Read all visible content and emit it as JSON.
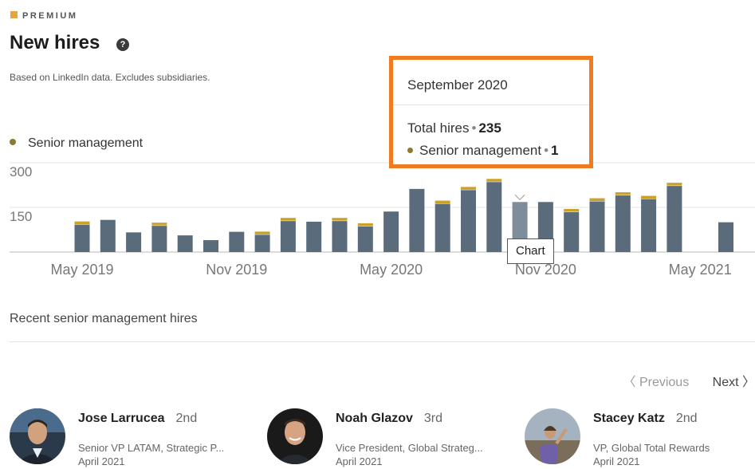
{
  "header": {
    "premium_label": "PREMIUM",
    "title": "New hires",
    "subtitle": "Based on LinkedIn data. Excludes subsidiaries."
  },
  "legend": {
    "label": "Senior management"
  },
  "chart_data": {
    "type": "bar",
    "stacked": true,
    "ylim": [
      0,
      300
    ],
    "y_ticks": [
      "300",
      "150"
    ],
    "x_tick_labels": [
      "May 2019",
      "Nov 2019",
      "May 2020",
      "Nov 2020",
      "May 2021"
    ],
    "x_tick_indices": [
      0,
      6,
      12,
      18,
      24
    ],
    "categories": [
      "Apr 2019",
      "May 2019",
      "Jun 2019",
      "Jul 2019",
      "Aug 2019",
      "Sep 2019",
      "Oct 2019",
      "Nov 2019",
      "Dec 2019",
      "Jan 2020",
      "Feb 2020",
      "Mar 2020",
      "Apr 2020",
      "May 2020",
      "Jun 2020",
      "Jul 2020",
      "Aug 2020",
      "Sep 2020",
      "Oct 2020",
      "Nov 2020",
      "Dec 2020",
      "Jan 2021",
      "Feb 2021",
      "Mar 2021",
      "Apr 2021",
      "May 2021"
    ],
    "highlight_index": 17,
    "series": [
      {
        "name": "Total hires",
        "color": "#5a6b7b",
        "values": [
          92,
          108,
          66,
          88,
          56,
          40,
          68,
          58,
          104,
          102,
          104,
          86,
          136,
          212,
          162,
          208,
          235,
          168,
          168,
          134,
          170,
          190,
          178,
          222,
          0,
          100
        ]
      },
      {
        "name": "Senior management",
        "color": "#c9a227",
        "values": [
          1,
          0,
          0,
          1,
          0,
          0,
          0,
          1,
          1,
          0,
          1,
          1,
          0,
          0,
          1,
          1,
          1,
          0,
          0,
          1,
          1,
          1,
          1,
          1,
          0,
          0
        ]
      }
    ]
  },
  "tooltip": {
    "month": "September 2020",
    "total_label": "Total hires",
    "total_value": "235",
    "senior_label": "Senior management",
    "senior_value": "1"
  },
  "chart_tooltip": "Chart",
  "recent": {
    "label": "Recent senior management hires",
    "pager": {
      "previous": "Previous",
      "next": "Next"
    },
    "people": [
      {
        "name": "Jose Larrucea",
        "degree": "2nd",
        "role": "Senior VP LATAM, Strategic P...",
        "date": "April 2021"
      },
      {
        "name": "Noah Glazov",
        "degree": "3rd",
        "role": "Vice President, Global Strateg...",
        "date": "April 2021"
      },
      {
        "name": "Stacey Katz",
        "degree": "2nd",
        "role": "VP, Global Total Rewards",
        "date": "April 2021"
      }
    ]
  },
  "colors": {
    "accent_orange": "#f07b21",
    "bar": "#5a6b7b",
    "bar_highlight": "#7d8d9b",
    "senior_gold": "#c9a227",
    "premium_gold": "#e7a33e"
  }
}
